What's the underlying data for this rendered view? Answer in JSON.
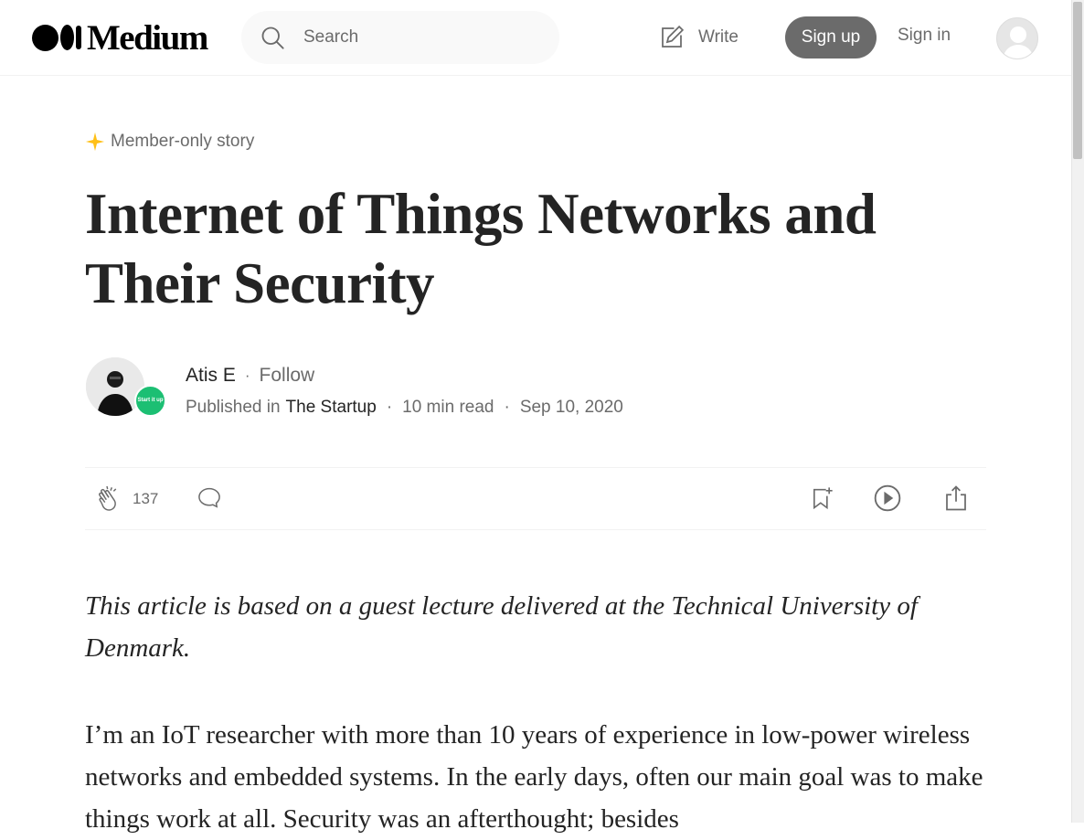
{
  "header": {
    "logo_text": "Medium",
    "search_placeholder": "Search",
    "write_label": "Write",
    "signup_label": "Sign up",
    "signin_label": "Sign in"
  },
  "article": {
    "member_label": "Member-only story",
    "title": "Internet of Things Networks and Their Security",
    "author": {
      "name": "Atis E",
      "follow_label": "Follow",
      "published_in_label": "Published in",
      "publication": "The Startup",
      "publication_badge": "Start it up",
      "read_time": "10 min read",
      "date": "Sep 10, 2020"
    },
    "actions": {
      "clap_count": "137"
    },
    "intro": "This article is based on a guest lecture delivered at the Technical University of Denmark.",
    "paragraph1": "I’m an IoT researcher with more than 10 years of experience in low-power wireless networks and embedded systems. In the early days, often our main goal was to make things work at all. Security was an afterthought; besides"
  },
  "colors": {
    "text": "#242424",
    "muted": "#6b6b6b",
    "signup_bg": "#6b6b6b",
    "member_star": "#ffc017",
    "publication_badge": "#1cbf73"
  }
}
